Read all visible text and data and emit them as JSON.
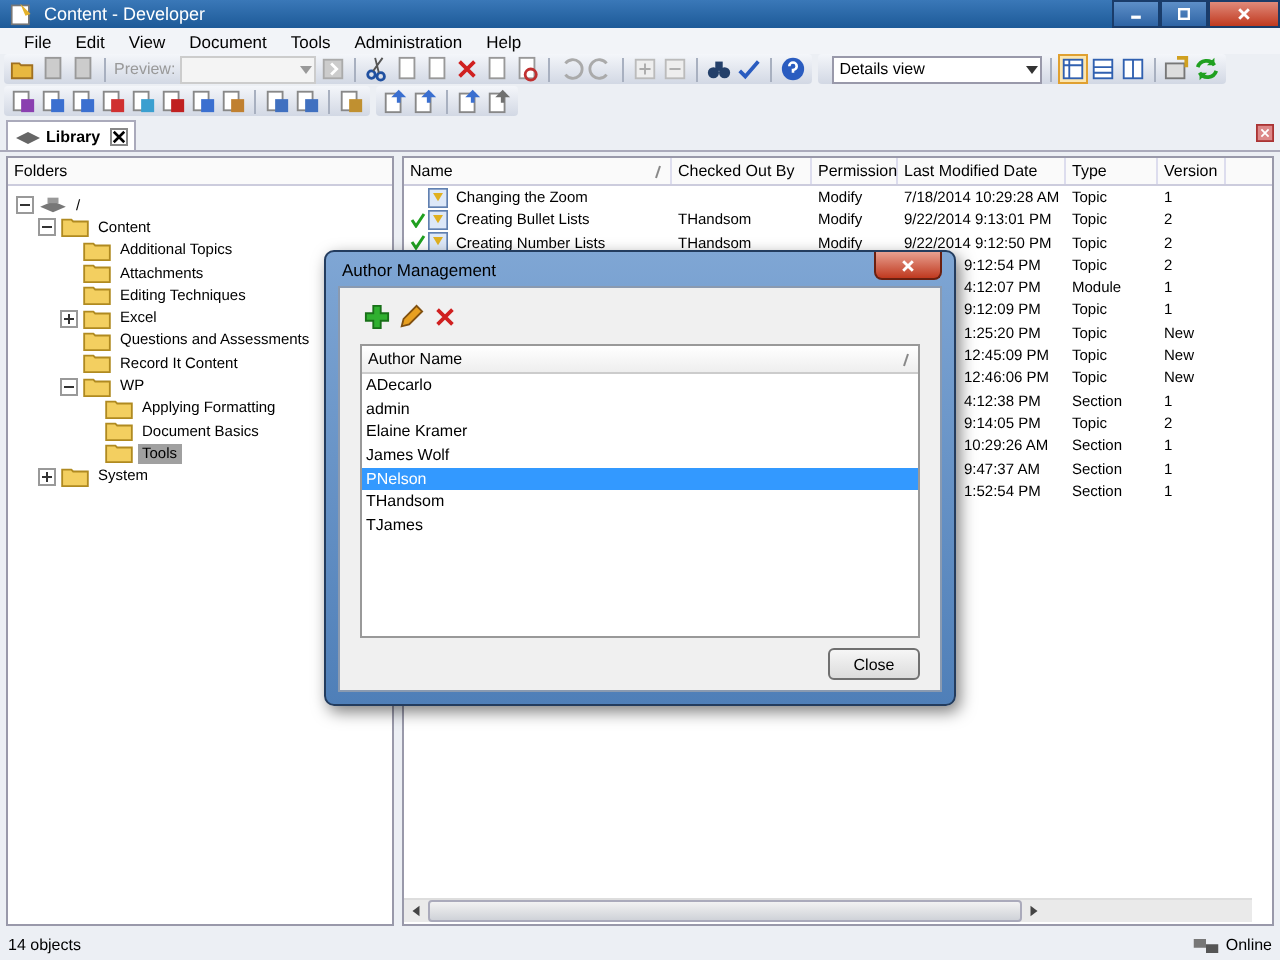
{
  "window": {
    "title": "Content - Developer"
  },
  "menu": [
    "File",
    "Edit",
    "View",
    "Document",
    "Tools",
    "Administration",
    "Help"
  ],
  "toolbar": {
    "preview_label": "Preview:",
    "view_select": "Details view"
  },
  "tabs": [
    {
      "label": "Library",
      "selected": true
    }
  ],
  "folders": {
    "header": "Folders",
    "tree": [
      {
        "label": "/",
        "kind": "drive",
        "expanded": true,
        "selected": false,
        "children": [
          {
            "label": "Content",
            "expanded": true,
            "selected": false,
            "children": [
              {
                "label": "Additional Topics",
                "selected": false
              },
              {
                "label": "Attachments",
                "selected": false
              },
              {
                "label": "Editing Techniques",
                "selected": false
              },
              {
                "label": "Excel",
                "expanded": false,
                "selected": false
              },
              {
                "label": "Questions and Assessments",
                "selected": false
              },
              {
                "label": "Record It Content",
                "selected": false
              },
              {
                "label": "WP",
                "expanded": true,
                "selected": false,
                "children": [
                  {
                    "label": "Applying Formatting",
                    "selected": false
                  },
                  {
                    "label": "Document Basics",
                    "selected": false
                  },
                  {
                    "label": "Tools",
                    "selected": true
                  }
                ]
              }
            ]
          },
          {
            "label": "System",
            "expanded": false,
            "selected": false
          }
        ]
      }
    ]
  },
  "table": {
    "columns": [
      "Name",
      "Checked Out By",
      "Permission",
      "Last Modified Date",
      "Type",
      "Version"
    ],
    "rows": [
      {
        "name": "Changing the Zoom",
        "checked_out": false,
        "checked_out_by": "",
        "permission": "Modify",
        "date": "7/18/2014 10:29:28 AM",
        "type": "Topic",
        "version": "1"
      },
      {
        "name": "Creating Bullet Lists",
        "checked_out": true,
        "checked_out_by": "THandsom",
        "permission": "Modify",
        "date": "9/22/2014 9:13:01 PM",
        "type": "Topic",
        "version": "2"
      },
      {
        "name": "Creating Number Lists",
        "checked_out": true,
        "checked_out_by": "THandsom",
        "permission": "Modify",
        "date": "9/22/2014 9:12:50 PM",
        "type": "Topic",
        "version": "2"
      },
      {
        "date": "9:12:54 PM",
        "type": "Topic",
        "version": "2"
      },
      {
        "date": "4:12:07 PM",
        "type": "Module",
        "version": "1"
      },
      {
        "date": "9:12:09 PM",
        "type": "Topic",
        "version": "1"
      },
      {
        "date": "1:25:20 PM",
        "type": "Topic",
        "version": "New"
      },
      {
        "date": "12:45:09 PM",
        "type": "Topic",
        "version": "New"
      },
      {
        "date": "12:46:06 PM",
        "type": "Topic",
        "version": "New"
      },
      {
        "date": "4:12:38 PM",
        "type": "Section",
        "version": "1"
      },
      {
        "date": "9:14:05 PM",
        "type": "Topic",
        "version": "2"
      },
      {
        "date": "10:29:26 AM",
        "type": "Section",
        "version": "1"
      },
      {
        "date": "9:47:37 AM",
        "type": "Section",
        "version": "1"
      },
      {
        "date": "1:52:54 PM",
        "type": "Section",
        "version": "1"
      }
    ]
  },
  "dialog": {
    "title": "Author Management",
    "column": "Author Name",
    "authors": [
      {
        "name": "ADecarlo",
        "selected": false
      },
      {
        "name": "admin",
        "selected": false
      },
      {
        "name": "Elaine Kramer",
        "selected": false
      },
      {
        "name": "James Wolf",
        "selected": false
      },
      {
        "name": "PNelson",
        "selected": true
      },
      {
        "name": "THandsom",
        "selected": false
      },
      {
        "name": "TJames",
        "selected": false
      }
    ],
    "close_button": "Close"
  },
  "status_bar": {
    "count": "14 objects",
    "connection": "Online"
  }
}
